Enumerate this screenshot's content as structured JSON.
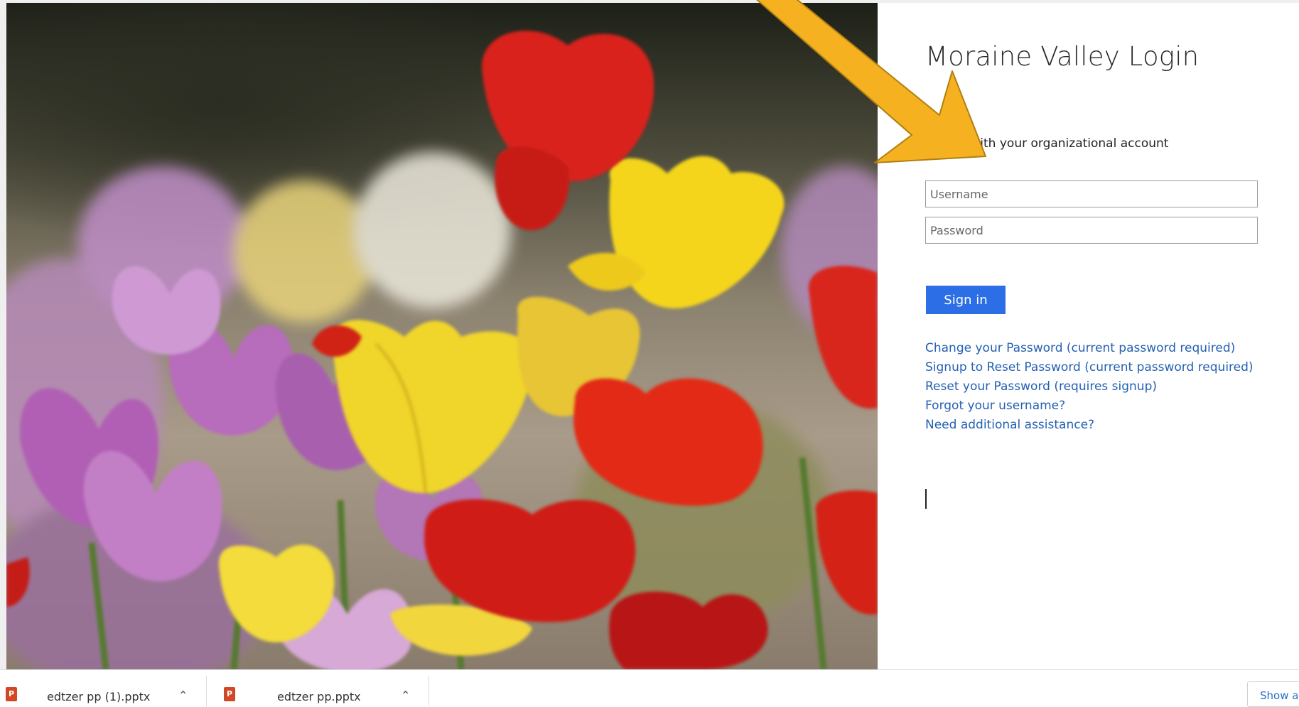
{
  "login": {
    "title": "Moraine Valley Login",
    "subtitle": "Sign in with your organizational account",
    "username_placeholder": "Username",
    "password_placeholder": "Password",
    "signin_label": "Sign in",
    "links": [
      "Change your Password (current password required)",
      "Signup to Reset Password (current password required)",
      "Reset your Password (requires signup)",
      "Forgot your username?",
      "Need additional assistance?"
    ]
  },
  "annotation": {
    "arrow_color": "#f5b120",
    "arrow_outline": "#b07f10"
  },
  "downloads": {
    "items": [
      {
        "name": "edtzer pp (1).pptx",
        "icon": "powerpoint-file-icon"
      },
      {
        "name": "edtzer pp.pptx",
        "icon": "powerpoint-file-icon"
      }
    ],
    "show_all_label": "Show all"
  },
  "colors": {
    "link": "#2460b3",
    "button": "#2b6ee5"
  }
}
